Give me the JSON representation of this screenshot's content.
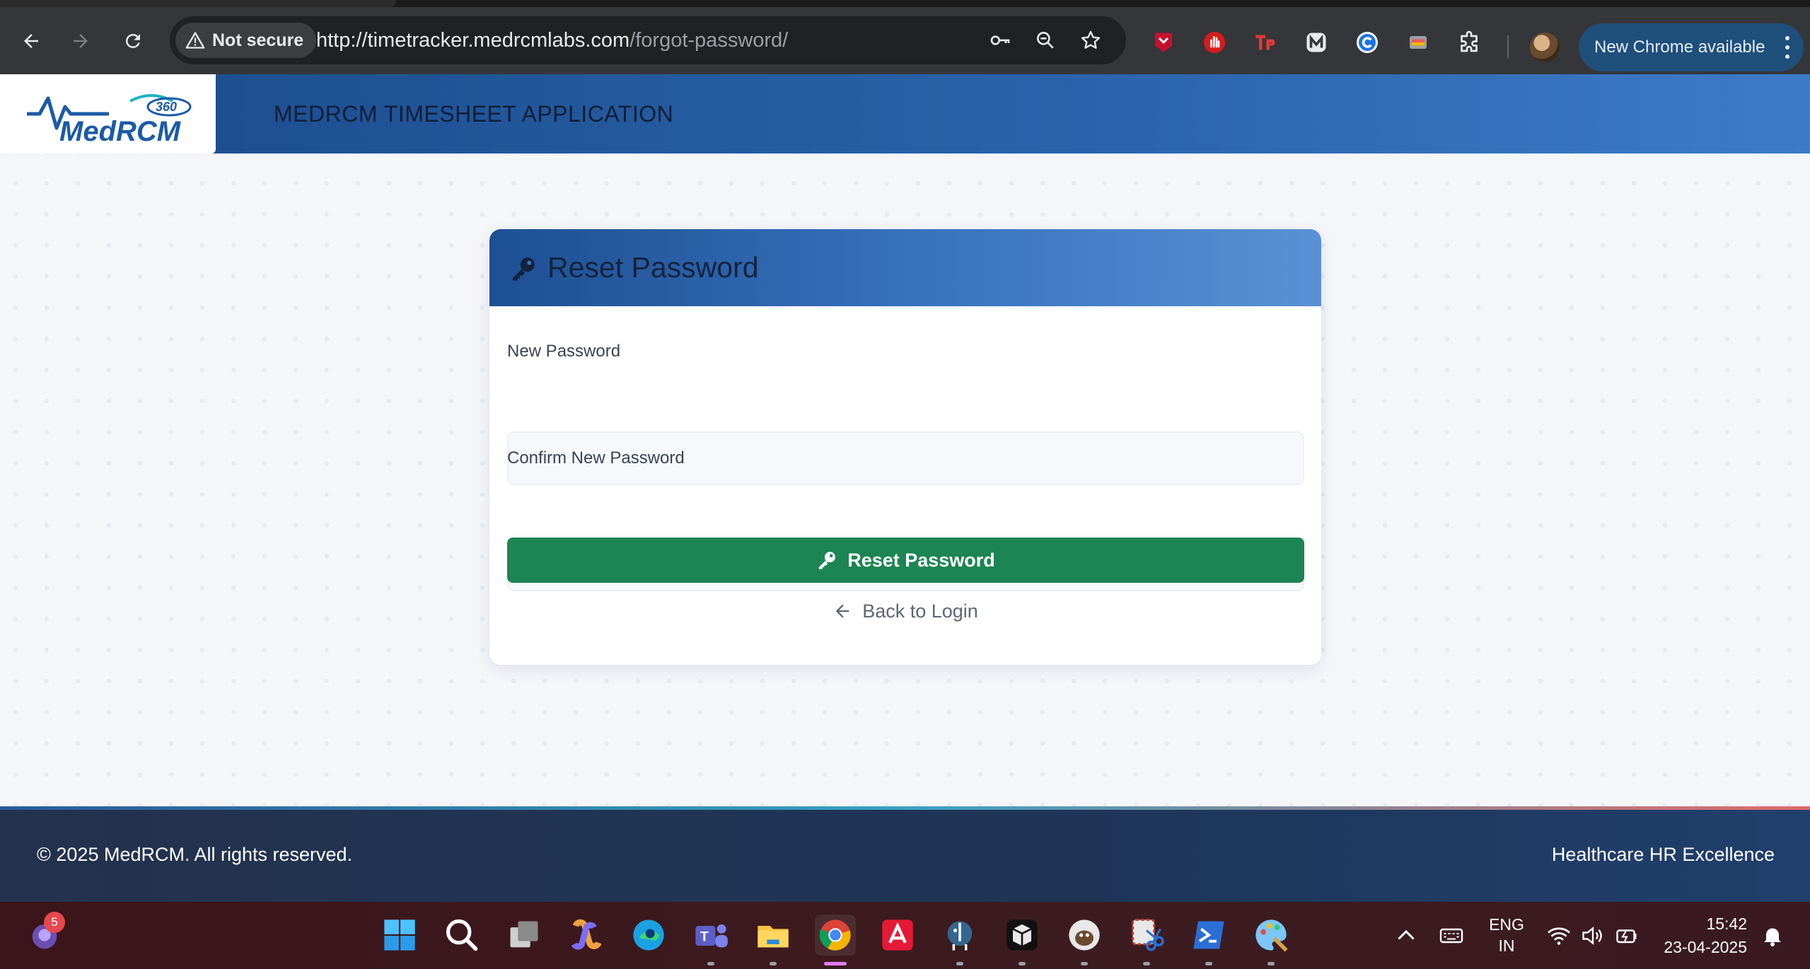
{
  "browser": {
    "security_label": "Not secure",
    "url_host": "http://timetracker.medrcmlabs.com",
    "url_path": "/forgot-password/",
    "update_label": "New Chrome available"
  },
  "app": {
    "title": "MEDRCM TIMESHEET APPLICATION",
    "logo_text": "MedRCM",
    "logo_badge": "360"
  },
  "form": {
    "heading": "Reset Password",
    "new_password_label": "New Password",
    "new_password_value": "",
    "confirm_password_label": "Confirm New Password",
    "confirm_password_value": "",
    "submit_label": "Reset Password",
    "back_label": "Back to Login"
  },
  "footer": {
    "copyright": "© 2025 MedRCM. All rights reserved.",
    "tagline": "Healthcare HR Excellence"
  },
  "taskbar": {
    "notification_count": "5",
    "language_line1": "ENG",
    "language_line2": "IN",
    "time": "15:42",
    "date": "23-04-2025"
  },
  "colors": {
    "header_blue": "#2a63ab",
    "submit_green": "#1d8454",
    "footer_navy": "#23324d"
  }
}
